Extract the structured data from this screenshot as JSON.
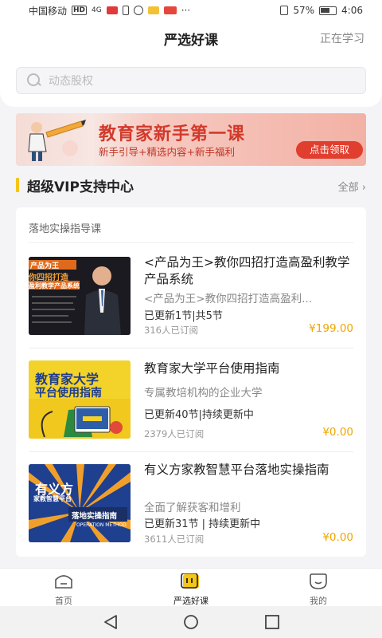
{
  "status_bar": {
    "carrier": "中国移动",
    "network": "HD",
    "signal": "4G",
    "battery": "57%",
    "time": "4:06",
    "more": "···"
  },
  "header": {
    "title": "严选好课",
    "right_link": "正在学习",
    "search_placeholder": "动态股权"
  },
  "banner": {
    "title": "教育家新手第一课",
    "subtitle": "新手引导+精选内容+新手福利",
    "cta": "点击领取"
  },
  "section": {
    "title": "超级VIP支持中心",
    "all_label": "全部",
    "accent": "#f5c518"
  },
  "card": {
    "heading": "落地实操指导课",
    "courses": [
      {
        "title": "<产品为王>教你四招打造高盈利教学产品系统",
        "desc": "<产品为王>教你四招打造高盈利...",
        "updates": "已更新1节|共5节",
        "subscribers": "316人已订阅",
        "price": "¥199.00",
        "thumb_text": [
          "产品为王",
          "你四招打造",
          "盈利教学产品系统"
        ]
      },
      {
        "title": "教育家大学平台使用指南",
        "desc": "专属教培机构的企业大学",
        "updates": "已更新40节|持续更新中",
        "subscribers": "2379人已订阅",
        "price": "¥0.00",
        "thumb_text": [
          "教育家大学",
          "平台使用指南"
        ]
      },
      {
        "title": "有义方家教智慧平台落地实操指南",
        "desc": "全面了解获客和增利",
        "updates": "已更新31节 | 持续更新中",
        "subscribers": "3611人已订阅",
        "price": "¥0.00",
        "thumb_text": [
          "有义方",
          "家教智慧平台",
          "落地实操指南",
          "OPERATION METHOD"
        ]
      }
    ]
  },
  "tabs": [
    {
      "label": "首页",
      "icon": "home-icon",
      "active": false
    },
    {
      "label": "严选好课",
      "icon": "courses-icon",
      "active": true
    },
    {
      "label": "我的",
      "icon": "profile-icon",
      "active": false
    }
  ],
  "colors": {
    "price": "#f0a500",
    "banner_red": "#d23a2b",
    "accent_yellow": "#f5c518"
  }
}
